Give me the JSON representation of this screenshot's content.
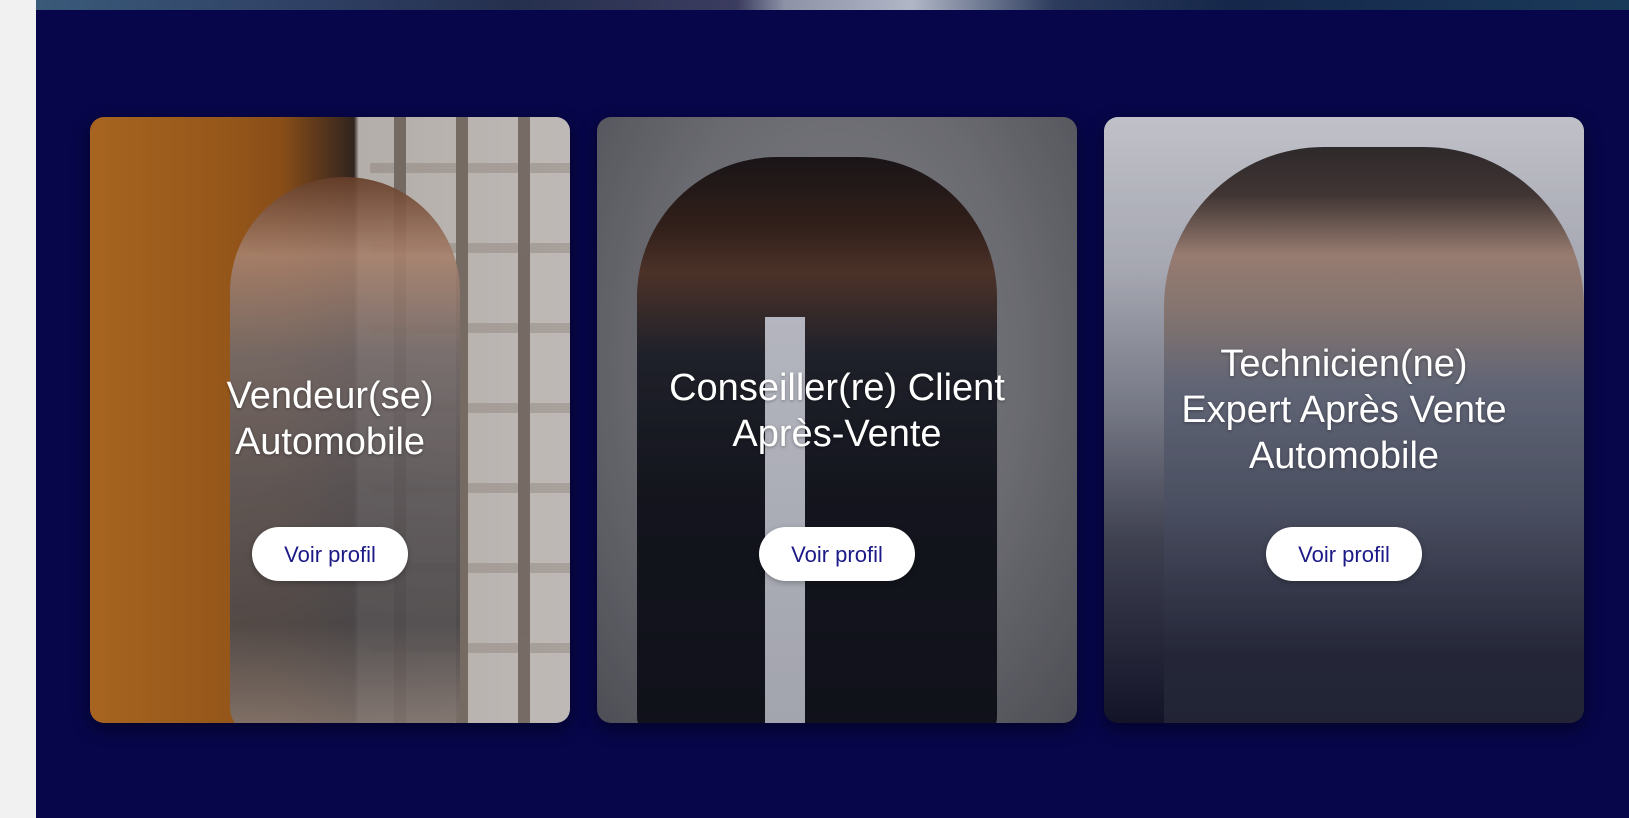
{
  "colors": {
    "section_bg": "#07064a",
    "button_bg": "#ffffff",
    "button_text": "#1c1a86",
    "title_text": "#ffffff"
  },
  "cards": [
    {
      "title": "Vendeur(se)\nAutomobile",
      "button_label": "Voir profil"
    },
    {
      "title": "Conseiller(re) Client\nAprès-Vente",
      "button_label": "Voir profil"
    },
    {
      "title": "Technicien(ne)\nExpert Après Vente\nAutomobile",
      "button_label": "Voir profil"
    }
  ]
}
